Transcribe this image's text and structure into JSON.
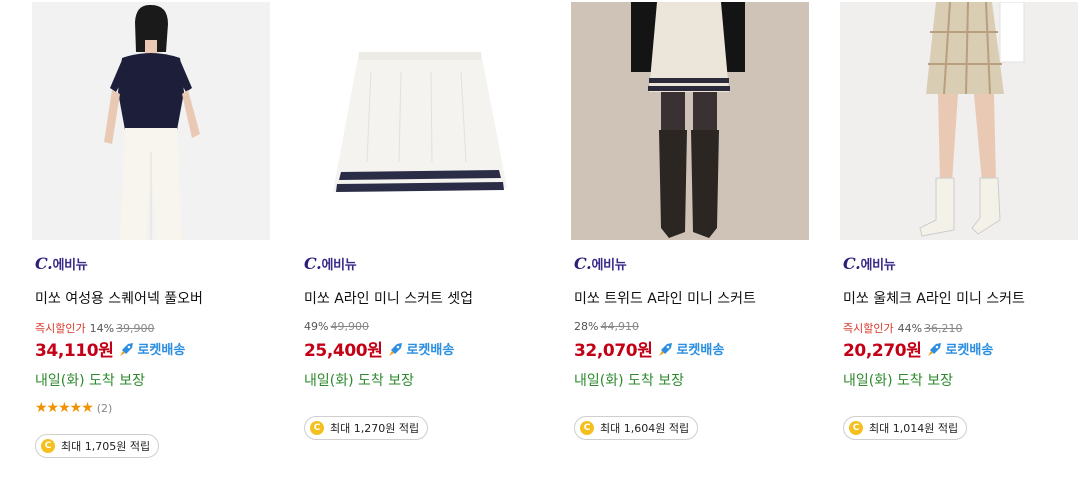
{
  "products": [
    {
      "brand_mark": "C.",
      "brand": "에비뉴",
      "name": "미쏘 여성용 스퀘어넥 풀오버",
      "instant_label": "즉시할인가",
      "discount": "14%",
      "original_price": "39,900",
      "price": "34,110원",
      "delivery_badge": "로켓배송",
      "delivery_promise": "내일(화) 도착 보장",
      "rating": 4.5,
      "rating_stars": "★★★★★",
      "review_count": "(2)",
      "cashback": "최대 1,705원 적립"
    },
    {
      "brand_mark": "C.",
      "brand": "에비뉴",
      "name": "미쏘 A라인 미니 스커트 셋업",
      "instant_label": "",
      "discount": "49%",
      "original_price": "49,900",
      "price": "25,400원",
      "delivery_badge": "로켓배송",
      "delivery_promise": "내일(화) 도착 보장",
      "cashback": "최대 1,270원 적립"
    },
    {
      "brand_mark": "C.",
      "brand": "에비뉴",
      "name": "미쏘 트위드 A라인 미니 스커트",
      "instant_label": "",
      "discount": "28%",
      "original_price": "44,910",
      "price": "32,070원",
      "delivery_badge": "로켓배송",
      "delivery_promise": "내일(화) 도착 보장",
      "cashback": "최대 1,604원 적립"
    },
    {
      "brand_mark": "C.",
      "brand": "에비뉴",
      "name": "미쏘 울체크 A라인 미니 스커트",
      "instant_label": "즉시할인가",
      "discount": "44%",
      "original_price": "36,210",
      "price": "20,270원",
      "delivery_badge": "로켓배송",
      "delivery_promise": "내일(화) 도착 보장",
      "cashback": "최대 1,014원 적립"
    }
  ],
  "coin_symbol": "C",
  "colors": {
    "price": "#c40016",
    "instant_discount": "#d8392c",
    "rocket": "#2b8ee0",
    "delivery": "#2d8a2d",
    "star": "#f09100",
    "brand": "#3b2a8a"
  }
}
